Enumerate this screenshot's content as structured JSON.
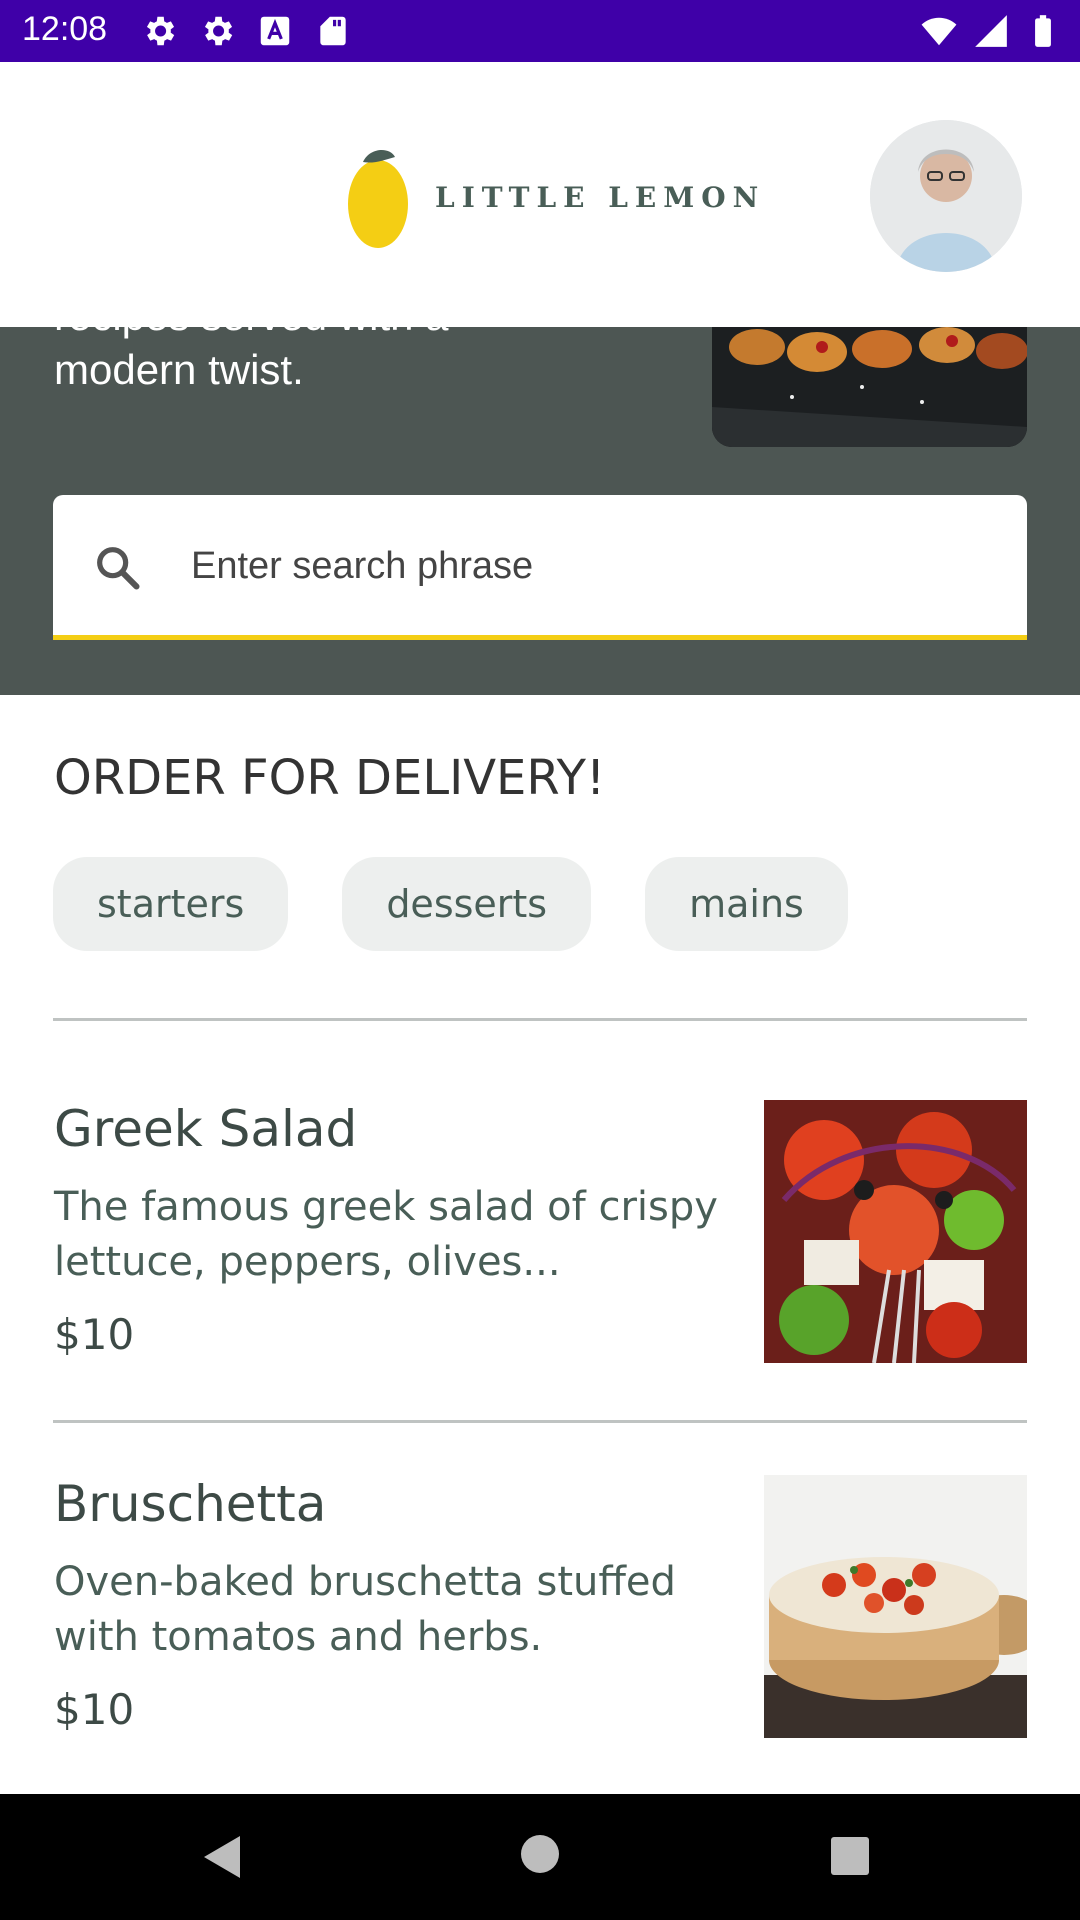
{
  "status_bar": {
    "time": "12:08",
    "left_icons": [
      "settings-icon",
      "settings-icon",
      "text-a-icon",
      "sd-card-icon"
    ],
    "right_icons": [
      "wifi-icon",
      "signal-icon",
      "battery-icon"
    ],
    "color": "#3f00a8"
  },
  "header": {
    "logo_text": "LITTLE LEMON",
    "avatar": "profile-avatar"
  },
  "hero": {
    "line1": "recipes served with a",
    "line2": "modern twist."
  },
  "search": {
    "placeholder": "Enter search phrase"
  },
  "order": {
    "title": "ORDER FOR DELIVERY!",
    "categories": [
      "starters",
      "desserts",
      "mains"
    ]
  },
  "menu": [
    {
      "title": "Greek Salad",
      "description": "The famous greek salad of crispy lettuce, peppers, olives...",
      "price": "$10"
    },
    {
      "title": "Bruschetta",
      "description": "Oven-baked bruschetta stuffed with tomatos and herbs.",
      "price": "$10"
    }
  ],
  "colors": {
    "accent_yellow": "#f4ce14",
    "brand_green": "#495e57",
    "chip_bg": "#edefee"
  },
  "nav": [
    "back-icon",
    "home-icon",
    "recents-icon"
  ]
}
